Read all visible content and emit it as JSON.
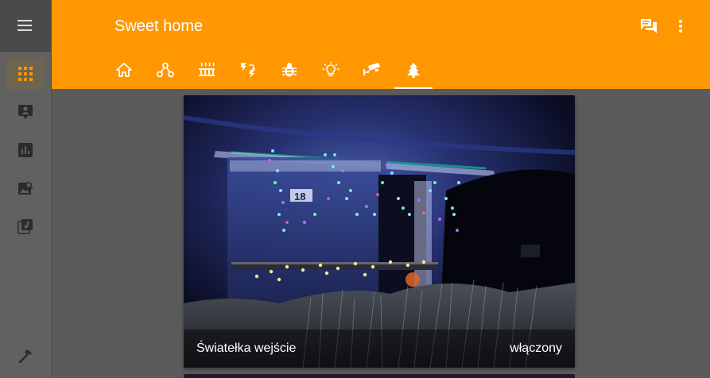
{
  "header": {
    "title": "Sweet home",
    "actions": [
      {
        "icon": "chat-icon"
      },
      {
        "icon": "more-vert-icon"
      }
    ]
  },
  "sidebar": {
    "items": [
      {
        "icon": "menu-icon"
      },
      {
        "icon": "grid-icon",
        "active": true
      },
      {
        "icon": "account-box-icon"
      },
      {
        "icon": "chart-icon"
      },
      {
        "icon": "image-search-icon"
      },
      {
        "icon": "library-music-icon"
      },
      {
        "icon": "hammer-icon"
      }
    ]
  },
  "tabs": [
    {
      "icon": "home-icon"
    },
    {
      "icon": "network-icon"
    },
    {
      "icon": "heater-icon"
    },
    {
      "icon": "weather-lightning-icon"
    },
    {
      "icon": "bug-icon"
    },
    {
      "icon": "lightbulb-icon"
    },
    {
      "icon": "cctv-icon"
    },
    {
      "icon": "tree-icon",
      "active": true
    }
  ],
  "card": {
    "name": "Światełka wejście",
    "state": "włączony"
  },
  "colors": {
    "accent": "#ff9800",
    "sidebar": "#616161",
    "background": "#5a5a5a"
  }
}
